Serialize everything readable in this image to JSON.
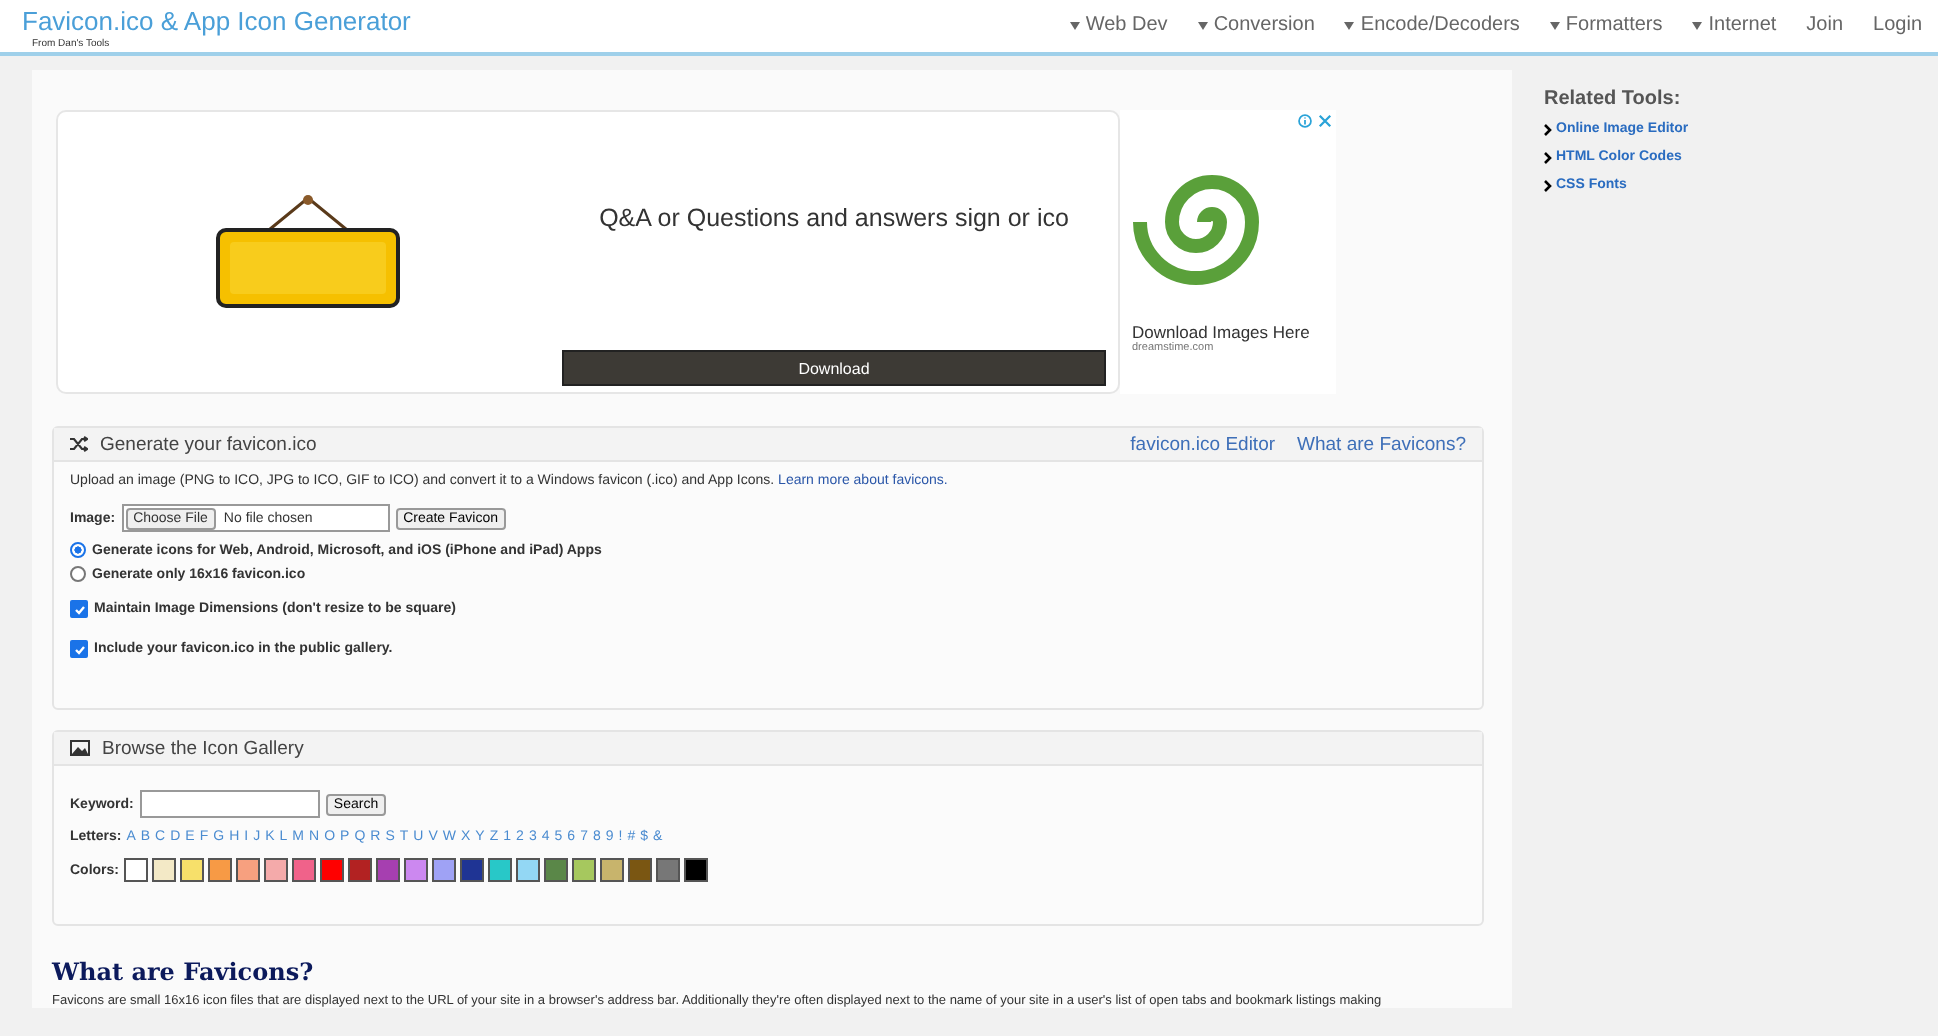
{
  "header": {
    "title": "Favicon.ico & App Icon Generator",
    "subtitle": "From Dan's Tools",
    "nav": [
      {
        "label": "Web Dev",
        "dropdown": true
      },
      {
        "label": "Conversion",
        "dropdown": true
      },
      {
        "label": "Encode/Decoders",
        "dropdown": true
      },
      {
        "label": "Formatters",
        "dropdown": true
      },
      {
        "label": "Internet",
        "dropdown": true
      },
      {
        "label": "Join",
        "dropdown": false
      },
      {
        "label": "Login",
        "dropdown": false
      }
    ]
  },
  "ad": {
    "headline": "Q&A or Questions and answers sign or ico",
    "button": "Download",
    "side_caption": "Download Images Here",
    "side_source": "dreamstime.com"
  },
  "generator": {
    "title": "Generate your favicon.ico",
    "links": [
      "favicon.ico Editor",
      "What are Favicons?"
    ],
    "intro": "Upload an image (PNG to ICO, JPG to ICO, GIF to ICO) and convert it to a Windows favicon (.ico) and App Icons.",
    "intro_link": "Learn more about favicons.",
    "image_label": "Image:",
    "file_button": "Choose File",
    "file_status": "No file chosen",
    "submit": "Create Favicon",
    "radios": [
      {
        "label": "Generate icons for Web, Android, Microsoft, and iOS (iPhone and iPad) Apps",
        "selected": true
      },
      {
        "label": "Generate only 16x16 favicon.ico",
        "selected": false
      }
    ],
    "checkboxes": [
      {
        "label": "Maintain Image Dimensions (don't resize to be square)",
        "checked": true
      },
      {
        "label": "Include your favicon.ico in the public gallery.",
        "checked": true
      }
    ]
  },
  "gallery": {
    "title": "Browse the Icon Gallery",
    "keyword_label": "Keyword:",
    "search": "Search",
    "letters_label": "Letters:",
    "letters": [
      "A",
      "B",
      "C",
      "D",
      "E",
      "F",
      "G",
      "H",
      "I",
      "J",
      "K",
      "L",
      "M",
      "N",
      "O",
      "P",
      "Q",
      "R",
      "S",
      "T",
      "U",
      "V",
      "W",
      "X",
      "Y",
      "Z",
      "1",
      "2",
      "3",
      "4",
      "5",
      "6",
      "7",
      "8",
      "9",
      "!",
      "#",
      "$",
      "&"
    ],
    "colors_label": "Colors:",
    "colors": [
      {
        "color": "#ffffff"
      },
      {
        "color": "#f3e9c6"
      },
      {
        "color": "#f7e06a"
      },
      {
        "color": "#f79a45"
      },
      {
        "color": "#f7a07f"
      },
      {
        "color": "#f4aaaa"
      },
      {
        "color": "#f0628a"
      },
      {
        "color": "#ff0000"
      },
      {
        "color": "#b22222"
      },
      {
        "color": "#a63fb0"
      },
      {
        "color": "#cc88f0"
      },
      {
        "color": "#9fa2f5"
      },
      {
        "color": "#1f3494"
      },
      {
        "color": "#28c8c8"
      },
      {
        "color": "#93d7f4"
      },
      {
        "color": "#5a8748"
      },
      {
        "color": "#a6c85e"
      },
      {
        "color": "#c8b46c"
      },
      {
        "color": "#7a5612"
      },
      {
        "color": "#777777"
      },
      {
        "color": "#000000"
      }
    ]
  },
  "article": {
    "heading": "What are Favicons?",
    "text": "Favicons are small 16x16 icon files that are displayed next to the URL of your site in a browser's address bar. Additionally they're often displayed next to the name of your site in a user's list of open tabs and bookmark listings making"
  },
  "sidebar": {
    "title": "Related Tools:",
    "items": [
      "Online Image Editor",
      "HTML Color Codes",
      "CSS Fonts"
    ]
  }
}
